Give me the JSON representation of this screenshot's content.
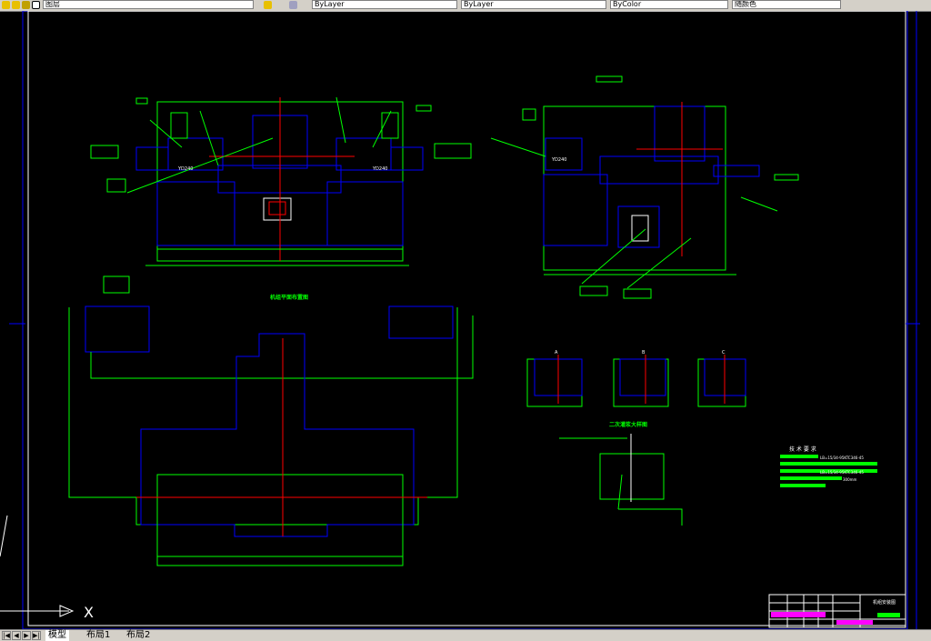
{
  "toolbar": {
    "layer_field": "图层",
    "linetype_field": "ByLayer",
    "lineweight_field": "ByLayer",
    "color_field": "ByColor",
    "extra_field": "随颜色"
  },
  "drawing": {
    "section_title": "机组平面布置图",
    "pump_label_left": "YD240",
    "pump_label_right": "YD240",
    "pump_label_side": "YD240",
    "view_a": "A",
    "view_b": "B",
    "view_c": "C",
    "detail_title": "二次灌浆大样图",
    "tech_title": "技 术 要 求",
    "tech_lines": [
      "LB=15/34-95KTC346-45",
      "LB=15/34-95KTC346-45",
      "300mm"
    ],
    "title_block_text": "机组安装图",
    "axis_label": "X"
  },
  "colors": {
    "green": "#00ff00",
    "blue": "#0000ff",
    "red": "#ff0000",
    "white": "#ffffff",
    "magenta": "#ff00ff",
    "frame_blue": "#0000ff"
  },
  "layout_tabs": {
    "model": "模型",
    "layout1": "布局1",
    "layout2": "布局2"
  }
}
